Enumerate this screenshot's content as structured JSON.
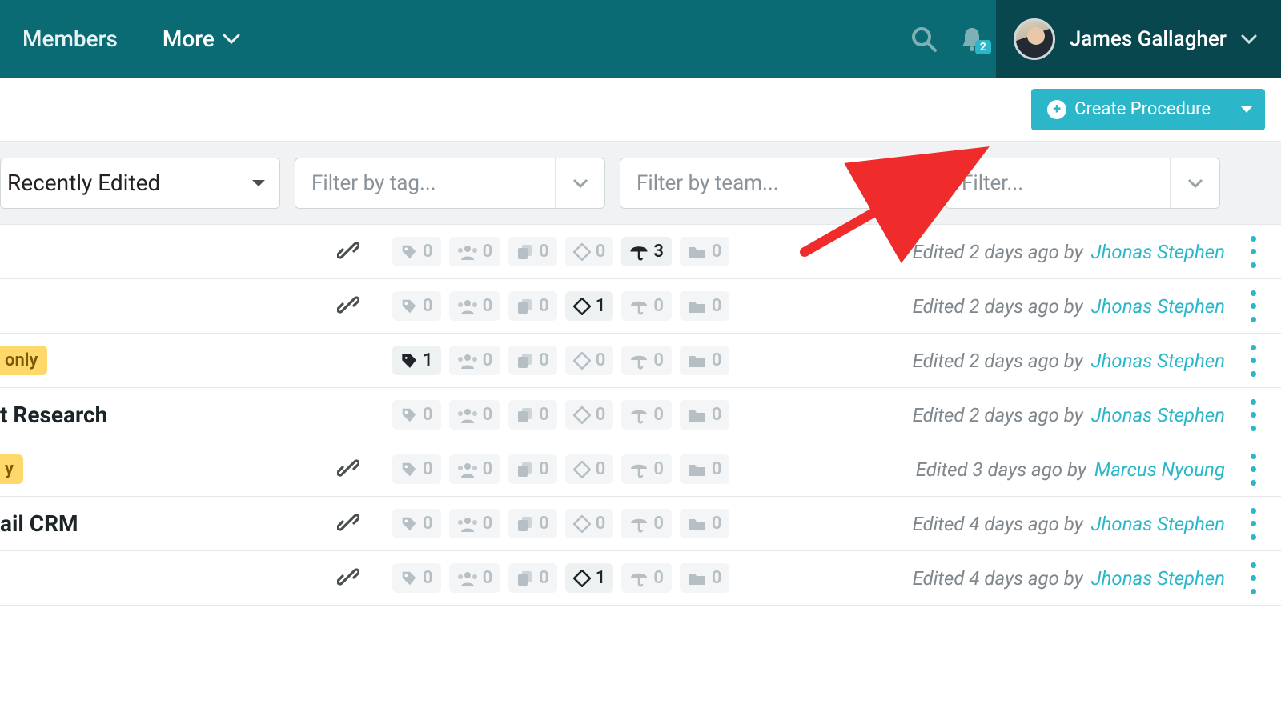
{
  "header": {
    "nav": {
      "members": "Members",
      "more": "More"
    },
    "notification_count": "2",
    "user_name": "James Gallagher"
  },
  "actions": {
    "create_label": "Create Procedure"
  },
  "filters": {
    "sort_selected": "Recently Edited",
    "tag_placeholder": "Filter by tag...",
    "team_placeholder": "Filter by team...",
    "extra_placeholder": "Filter..."
  },
  "rows": [
    {
      "title_fragment": "",
      "chip": null,
      "has_link": true,
      "stats": {
        "tags": {
          "n": "0",
          "on": false
        },
        "people": {
          "n": "0",
          "on": false
        },
        "copies": {
          "n": "0",
          "on": false
        },
        "diamond": {
          "n": "0",
          "on": false
        },
        "umbrella": {
          "n": "3",
          "on": true
        },
        "folder": {
          "n": "0",
          "on": false
        }
      },
      "edited_prefix": "Edited 2 days ago by ",
      "editor": "Jhonas Stephen"
    },
    {
      "title_fragment": "",
      "chip": null,
      "has_link": true,
      "stats": {
        "tags": {
          "n": "0",
          "on": false
        },
        "people": {
          "n": "0",
          "on": false
        },
        "copies": {
          "n": "0",
          "on": false
        },
        "diamond": {
          "n": "1",
          "on": true
        },
        "umbrella": {
          "n": "0",
          "on": false
        },
        "folder": {
          "n": "0",
          "on": false
        }
      },
      "edited_prefix": "Edited 2 days ago by ",
      "editor": "Jhonas Stephen"
    },
    {
      "title_fragment": "",
      "chip": "only",
      "has_link": false,
      "stats": {
        "tags": {
          "n": "1",
          "on": true
        },
        "people": {
          "n": "0",
          "on": false
        },
        "copies": {
          "n": "0",
          "on": false
        },
        "diamond": {
          "n": "0",
          "on": false
        },
        "umbrella": {
          "n": "0",
          "on": false
        },
        "folder": {
          "n": "0",
          "on": false
        }
      },
      "edited_prefix": "Edited 2 days ago by ",
      "editor": "Jhonas Stephen"
    },
    {
      "title_fragment": "t Research",
      "chip": null,
      "has_link": false,
      "stats": {
        "tags": {
          "n": "0",
          "on": false
        },
        "people": {
          "n": "0",
          "on": false
        },
        "copies": {
          "n": "0",
          "on": false
        },
        "diamond": {
          "n": "0",
          "on": false
        },
        "umbrella": {
          "n": "0",
          "on": false
        },
        "folder": {
          "n": "0",
          "on": false
        }
      },
      "edited_prefix": "Edited 2 days ago by ",
      "editor": "Jhonas Stephen"
    },
    {
      "title_fragment": "",
      "chip": "y",
      "has_link": true,
      "stats": {
        "tags": {
          "n": "0",
          "on": false
        },
        "people": {
          "n": "0",
          "on": false
        },
        "copies": {
          "n": "0",
          "on": false
        },
        "diamond": {
          "n": "0",
          "on": false
        },
        "umbrella": {
          "n": "0",
          "on": false
        },
        "folder": {
          "n": "0",
          "on": false
        }
      },
      "edited_prefix": "Edited 3 days ago by ",
      "editor": "Marcus Nyoung"
    },
    {
      "title_fragment": "ail CRM",
      "chip": null,
      "has_link": true,
      "stats": {
        "tags": {
          "n": "0",
          "on": false
        },
        "people": {
          "n": "0",
          "on": false
        },
        "copies": {
          "n": "0",
          "on": false
        },
        "diamond": {
          "n": "0",
          "on": false
        },
        "umbrella": {
          "n": "0",
          "on": false
        },
        "folder": {
          "n": "0",
          "on": false
        }
      },
      "edited_prefix": "Edited 4 days ago by ",
      "editor": "Jhonas Stephen"
    },
    {
      "title_fragment": "",
      "chip": null,
      "has_link": true,
      "stats": {
        "tags": {
          "n": "0",
          "on": false
        },
        "people": {
          "n": "0",
          "on": false
        },
        "copies": {
          "n": "0",
          "on": false
        },
        "diamond": {
          "n": "1",
          "on": true
        },
        "umbrella": {
          "n": "0",
          "on": false
        },
        "folder": {
          "n": "0",
          "on": false
        }
      },
      "edited_prefix": "Edited 4 days ago by ",
      "editor": "Jhonas Stephen"
    }
  ]
}
